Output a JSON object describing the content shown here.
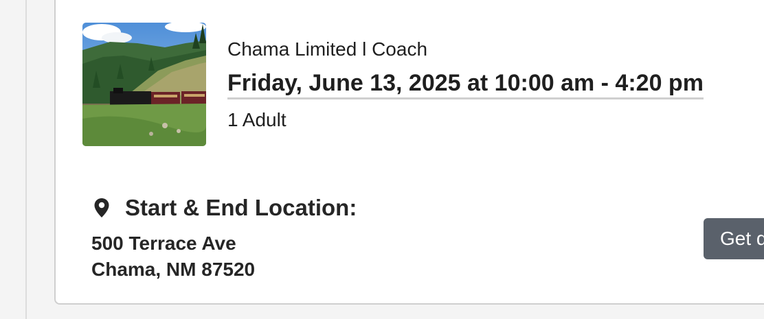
{
  "booking": {
    "product_name": "Chama Limited l Coach",
    "date_time": "Friday, June 13, 2025 at 10:00 am - 4:20 pm",
    "guests": "1 Adult",
    "thumbnail_icon": "train-photo"
  },
  "location": {
    "icon": "map-pin-icon",
    "heading": "Start & End Location:",
    "address_line1": "500 Terrace Ave",
    "address_line2": "Chama, NM 87520",
    "directions_label": "Get directions"
  },
  "colors": {
    "button_bg": "#5a616b",
    "text": "#1f1f1f",
    "card_border": "#cfcfcf"
  }
}
